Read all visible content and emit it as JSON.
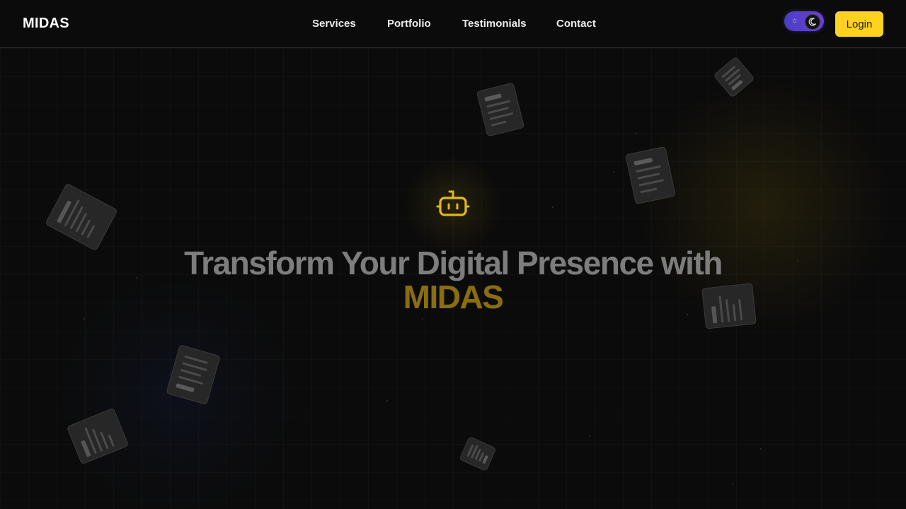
{
  "brand": {
    "name": "MIDAS"
  },
  "nav": {
    "items": [
      {
        "label": "Services"
      },
      {
        "label": "Portfolio"
      },
      {
        "label": "Testimonials"
      },
      {
        "label": "Contact"
      }
    ]
  },
  "header": {
    "theme_toggle": {
      "icon_light": "sun-icon",
      "icon_dark": "moon-icon",
      "state": "dark"
    },
    "login_label": "Login"
  },
  "hero": {
    "icon": "robot-icon",
    "title_line1": "Transform Your Digital Presence with",
    "title_highlight": "MIDAS"
  },
  "colors": {
    "accent": "#ffd21f",
    "highlight_text": "#8a6d0f",
    "toggle": "#5a3fd0",
    "background": "#0b0b0b"
  },
  "decorations": {
    "floating_icons": [
      "document-icon",
      "bar-chart-icon"
    ]
  }
}
